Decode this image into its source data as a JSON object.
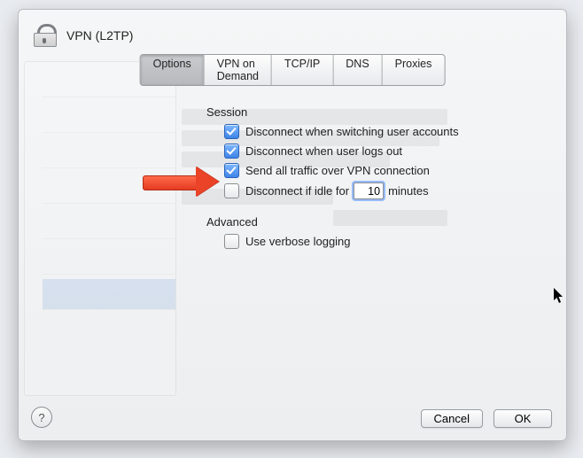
{
  "window": {
    "title": "VPN (L2TP)"
  },
  "tabs": [
    {
      "label": "Options"
    },
    {
      "label": "VPN on Demand"
    },
    {
      "label": "TCP/IP"
    },
    {
      "label": "DNS"
    },
    {
      "label": "Proxies"
    }
  ],
  "session": {
    "heading": "Session",
    "switch_users": "Disconnect when switching user accounts",
    "logout": "Disconnect when user logs out",
    "all_traffic": "Send all traffic over VPN connection",
    "idle_prefix": "Disconnect if idle for",
    "idle_value": "10",
    "idle_suffix": "minutes"
  },
  "advanced": {
    "heading": "Advanced",
    "verbose": "Use verbose logging"
  },
  "buttons": {
    "cancel": "Cancel",
    "ok": "OK"
  },
  "help": "?"
}
